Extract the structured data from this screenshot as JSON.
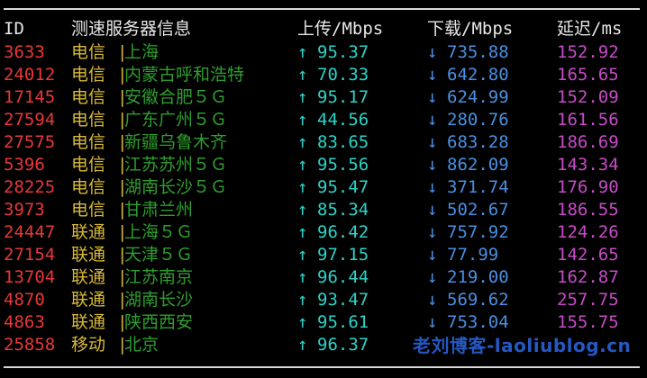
{
  "header": {
    "id": "ID",
    "info": "测速服务器信息",
    "upload": "上传/Mbps",
    "download": "下载/Mbps",
    "latency": "延迟/ms"
  },
  "arrows": {
    "up": "↑",
    "down": "↓",
    "separator": "|"
  },
  "rows": [
    {
      "id": "3633",
      "isp": "电信",
      "city": "上海",
      "up": "95.37",
      "down": "735.88",
      "latency": "152.92"
    },
    {
      "id": "24012",
      "isp": "电信",
      "city": "内蒙古呼和浩特",
      "up": "70.33",
      "down": "642.80",
      "latency": "165.65"
    },
    {
      "id": "17145",
      "isp": "电信",
      "city": "安徽合肥５Ｇ",
      "up": "95.17",
      "down": "624.99",
      "latency": "152.09"
    },
    {
      "id": "27594",
      "isp": "电信",
      "city": "广东广州５Ｇ",
      "up": "44.56",
      "down": "280.76",
      "latency": "161.56"
    },
    {
      "id": "27575",
      "isp": "电信",
      "city": "新疆乌鲁木齐",
      "up": "83.65",
      "down": "683.28",
      "latency": "186.69"
    },
    {
      "id": "5396",
      "isp": "电信",
      "city": "江苏苏州５Ｇ",
      "up": "95.56",
      "down": "862.09",
      "latency": "143.34"
    },
    {
      "id": "28225",
      "isp": "电信",
      "city": "湖南长沙５Ｇ",
      "up": "95.47",
      "down": "371.74",
      "latency": "176.90"
    },
    {
      "id": "3973",
      "isp": "电信",
      "city": "甘肃兰州",
      "up": "85.34",
      "down": "502.67",
      "latency": "186.55"
    },
    {
      "id": "24447",
      "isp": "联通",
      "city": "上海５Ｇ",
      "up": "96.42",
      "down": "757.92",
      "latency": "124.26"
    },
    {
      "id": "27154",
      "isp": "联通",
      "city": "天津５Ｇ",
      "up": "97.15",
      "down": "77.99",
      "latency": "142.65"
    },
    {
      "id": "13704",
      "isp": "联通",
      "city": "江苏南京",
      "up": "96.44",
      "down": "219.00",
      "latency": "162.87"
    },
    {
      "id": "4870",
      "isp": "联通",
      "city": "湖南长沙",
      "up": "93.47",
      "down": "569.62",
      "latency": "257.75"
    },
    {
      "id": "4863",
      "isp": "联通",
      "city": "陕西西安",
      "up": "95.61",
      "down": "753.04",
      "latency": "155.75"
    },
    {
      "id": "25858",
      "isp": "移动",
      "city": "北京",
      "up": "96.37",
      "down": "",
      "latency": ""
    }
  ],
  "watermark": "老刘博客-laoliublog.cn"
}
